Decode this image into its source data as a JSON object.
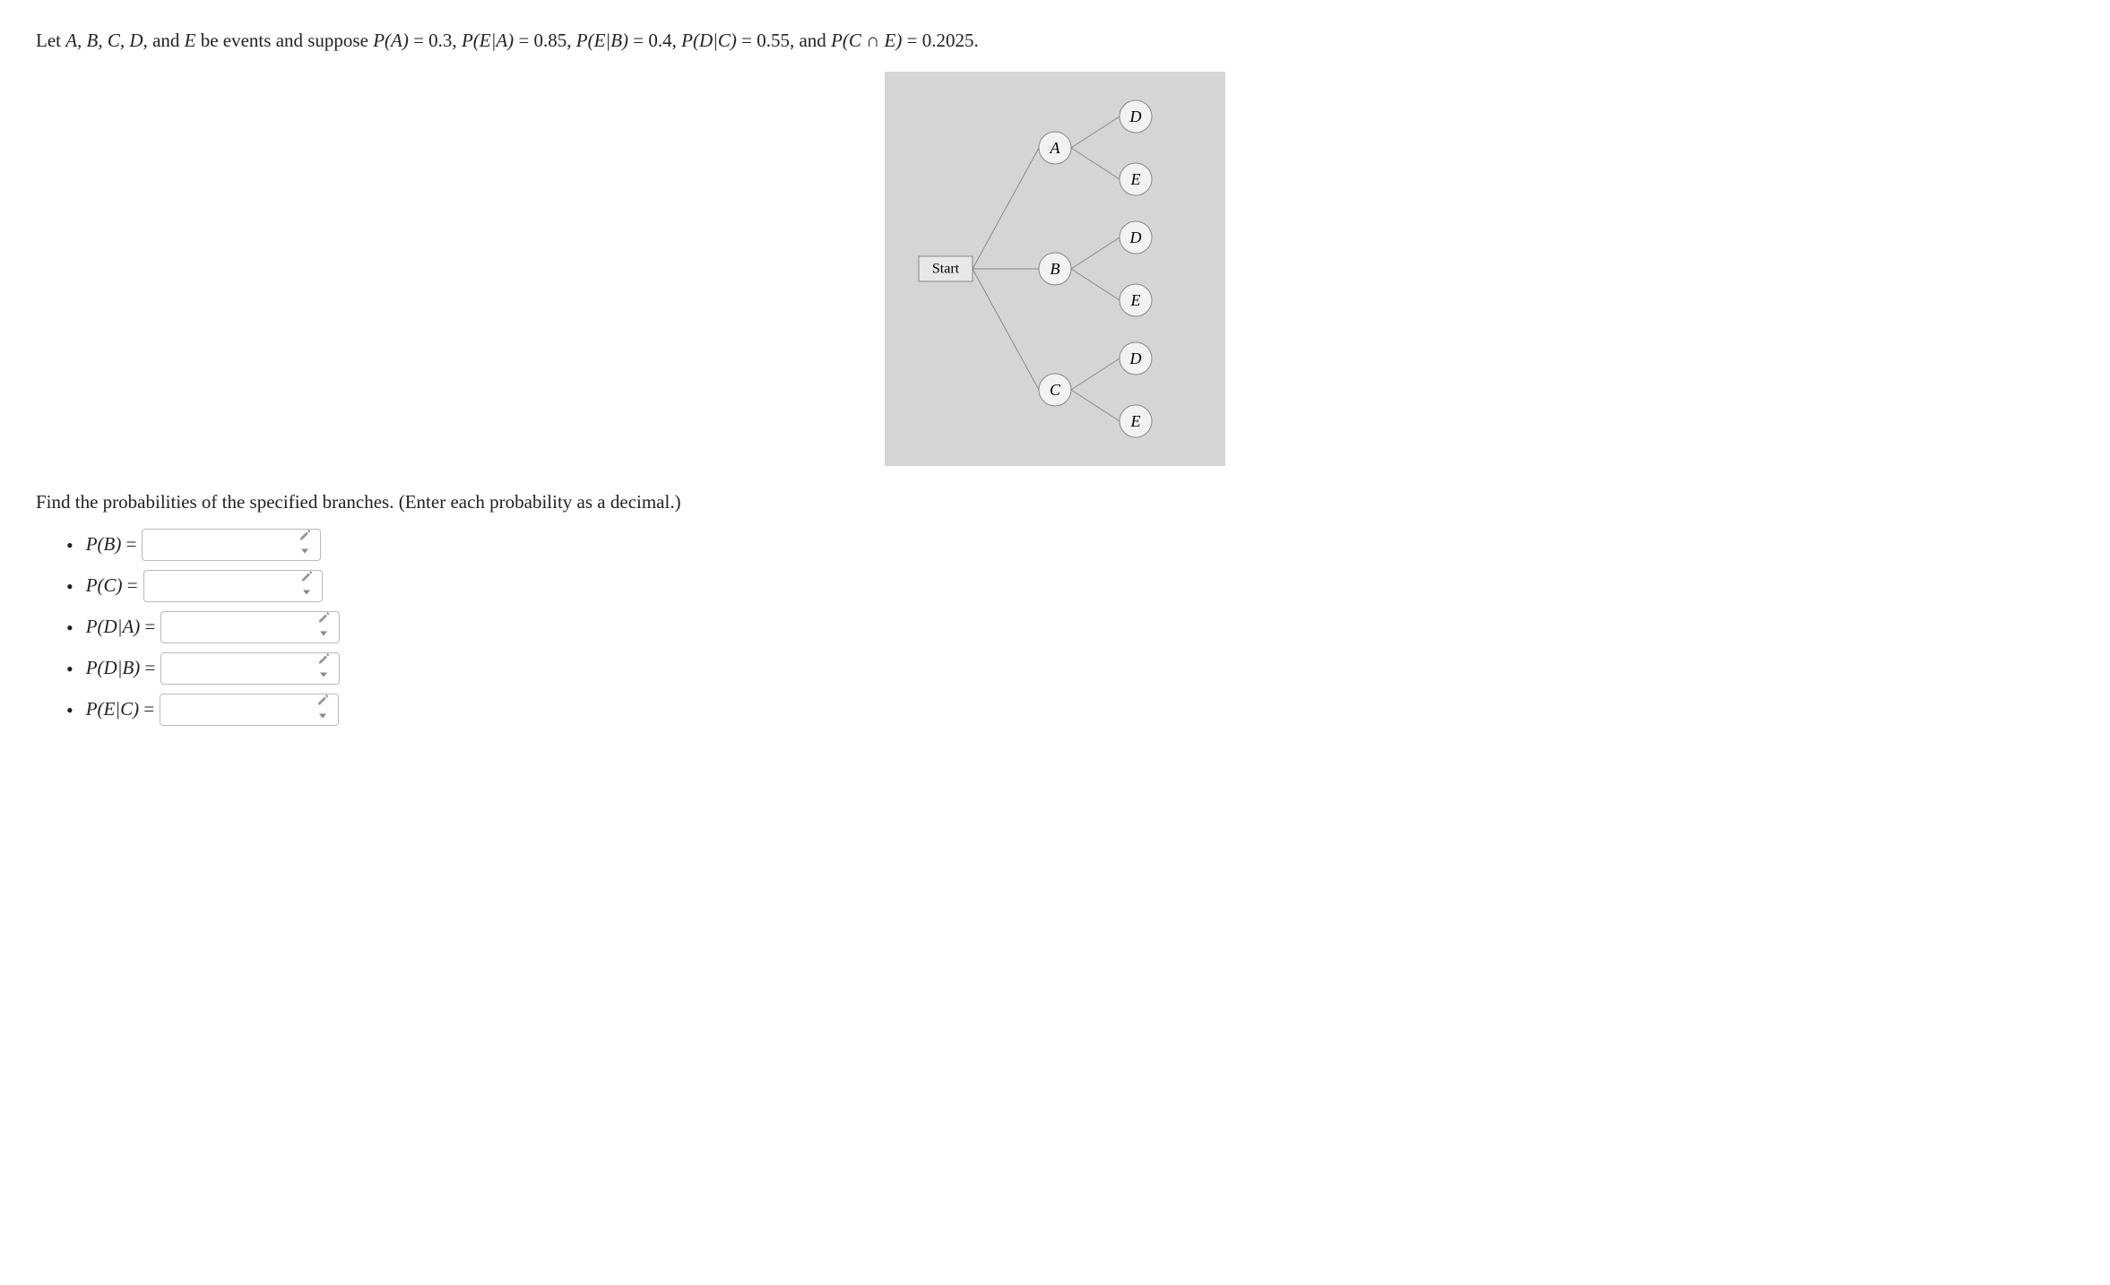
{
  "problem": {
    "prefix": "Let ",
    "vars_list": "A, B, C, D,",
    "and": " and ",
    "last_var": "E",
    "middle": " be events and suppose ",
    "eq1_lhs": "P(A)",
    "eq1_rhs": " = 0.3, ",
    "eq2_lhs": "P(E|A)",
    "eq2_rhs": " = 0.85, ",
    "eq3_lhs": "P(E|B)",
    "eq3_rhs": " = 0.4, ",
    "eq4_lhs": "P(D|C)",
    "eq4_rhs": " = 0.55, and ",
    "eq5_lhs": "P(C ∩ E)",
    "eq5_rhs": " = 0.2025."
  },
  "diagram": {
    "start": "Start",
    "level1": [
      "A",
      "B",
      "C"
    ],
    "level2": [
      "D",
      "E",
      "D",
      "E",
      "D",
      "E"
    ]
  },
  "instruction": "Find the probabilities of the specified branches. (Enter each probability as a decimal.)",
  "answers": [
    {
      "label_math": "P(B)",
      "label_suffix": " ="
    },
    {
      "label_math": "P(C)",
      "label_suffix": " ="
    },
    {
      "label_math": "P(D|A)",
      "label_suffix": " ="
    },
    {
      "label_math": "P(D|B)",
      "label_suffix": " ="
    },
    {
      "label_math": "P(E|C)",
      "label_suffix": " ="
    }
  ]
}
